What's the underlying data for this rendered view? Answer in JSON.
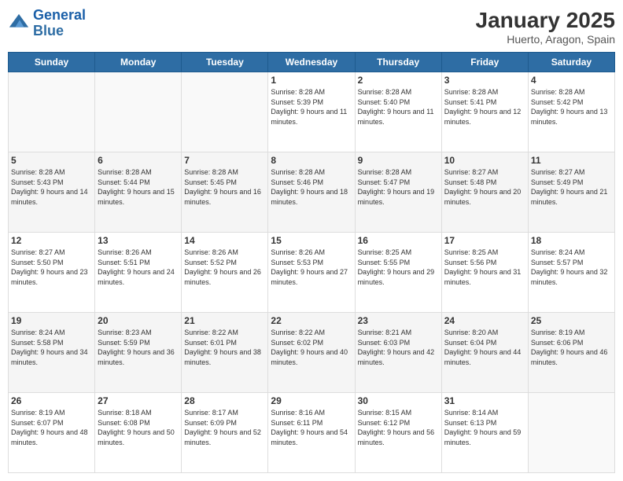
{
  "logo": {
    "line1": "General",
    "line2": "Blue"
  },
  "title": "January 2025",
  "subtitle": "Huerto, Aragon, Spain",
  "days_header": [
    "Sunday",
    "Monday",
    "Tuesday",
    "Wednesday",
    "Thursday",
    "Friday",
    "Saturday"
  ],
  "weeks": [
    [
      {
        "day": "",
        "sunrise": "",
        "sunset": "",
        "daylight": ""
      },
      {
        "day": "",
        "sunrise": "",
        "sunset": "",
        "daylight": ""
      },
      {
        "day": "",
        "sunrise": "",
        "sunset": "",
        "daylight": ""
      },
      {
        "day": "1",
        "sunrise": "Sunrise: 8:28 AM",
        "sunset": "Sunset: 5:39 PM",
        "daylight": "Daylight: 9 hours and 11 minutes."
      },
      {
        "day": "2",
        "sunrise": "Sunrise: 8:28 AM",
        "sunset": "Sunset: 5:40 PM",
        "daylight": "Daylight: 9 hours and 11 minutes."
      },
      {
        "day": "3",
        "sunrise": "Sunrise: 8:28 AM",
        "sunset": "Sunset: 5:41 PM",
        "daylight": "Daylight: 9 hours and 12 minutes."
      },
      {
        "day": "4",
        "sunrise": "Sunrise: 8:28 AM",
        "sunset": "Sunset: 5:42 PM",
        "daylight": "Daylight: 9 hours and 13 minutes."
      }
    ],
    [
      {
        "day": "5",
        "sunrise": "Sunrise: 8:28 AM",
        "sunset": "Sunset: 5:43 PM",
        "daylight": "Daylight: 9 hours and 14 minutes."
      },
      {
        "day": "6",
        "sunrise": "Sunrise: 8:28 AM",
        "sunset": "Sunset: 5:44 PM",
        "daylight": "Daylight: 9 hours and 15 minutes."
      },
      {
        "day": "7",
        "sunrise": "Sunrise: 8:28 AM",
        "sunset": "Sunset: 5:45 PM",
        "daylight": "Daylight: 9 hours and 16 minutes."
      },
      {
        "day": "8",
        "sunrise": "Sunrise: 8:28 AM",
        "sunset": "Sunset: 5:46 PM",
        "daylight": "Daylight: 9 hours and 18 minutes."
      },
      {
        "day": "9",
        "sunrise": "Sunrise: 8:28 AM",
        "sunset": "Sunset: 5:47 PM",
        "daylight": "Daylight: 9 hours and 19 minutes."
      },
      {
        "day": "10",
        "sunrise": "Sunrise: 8:27 AM",
        "sunset": "Sunset: 5:48 PM",
        "daylight": "Daylight: 9 hours and 20 minutes."
      },
      {
        "day": "11",
        "sunrise": "Sunrise: 8:27 AM",
        "sunset": "Sunset: 5:49 PM",
        "daylight": "Daylight: 9 hours and 21 minutes."
      }
    ],
    [
      {
        "day": "12",
        "sunrise": "Sunrise: 8:27 AM",
        "sunset": "Sunset: 5:50 PM",
        "daylight": "Daylight: 9 hours and 23 minutes."
      },
      {
        "day": "13",
        "sunrise": "Sunrise: 8:26 AM",
        "sunset": "Sunset: 5:51 PM",
        "daylight": "Daylight: 9 hours and 24 minutes."
      },
      {
        "day": "14",
        "sunrise": "Sunrise: 8:26 AM",
        "sunset": "Sunset: 5:52 PM",
        "daylight": "Daylight: 9 hours and 26 minutes."
      },
      {
        "day": "15",
        "sunrise": "Sunrise: 8:26 AM",
        "sunset": "Sunset: 5:53 PM",
        "daylight": "Daylight: 9 hours and 27 minutes."
      },
      {
        "day": "16",
        "sunrise": "Sunrise: 8:25 AM",
        "sunset": "Sunset: 5:55 PM",
        "daylight": "Daylight: 9 hours and 29 minutes."
      },
      {
        "day": "17",
        "sunrise": "Sunrise: 8:25 AM",
        "sunset": "Sunset: 5:56 PM",
        "daylight": "Daylight: 9 hours and 31 minutes."
      },
      {
        "day": "18",
        "sunrise": "Sunrise: 8:24 AM",
        "sunset": "Sunset: 5:57 PM",
        "daylight": "Daylight: 9 hours and 32 minutes."
      }
    ],
    [
      {
        "day": "19",
        "sunrise": "Sunrise: 8:24 AM",
        "sunset": "Sunset: 5:58 PM",
        "daylight": "Daylight: 9 hours and 34 minutes."
      },
      {
        "day": "20",
        "sunrise": "Sunrise: 8:23 AM",
        "sunset": "Sunset: 5:59 PM",
        "daylight": "Daylight: 9 hours and 36 minutes."
      },
      {
        "day": "21",
        "sunrise": "Sunrise: 8:22 AM",
        "sunset": "Sunset: 6:01 PM",
        "daylight": "Daylight: 9 hours and 38 minutes."
      },
      {
        "day": "22",
        "sunrise": "Sunrise: 8:22 AM",
        "sunset": "Sunset: 6:02 PM",
        "daylight": "Daylight: 9 hours and 40 minutes."
      },
      {
        "day": "23",
        "sunrise": "Sunrise: 8:21 AM",
        "sunset": "Sunset: 6:03 PM",
        "daylight": "Daylight: 9 hours and 42 minutes."
      },
      {
        "day": "24",
        "sunrise": "Sunrise: 8:20 AM",
        "sunset": "Sunset: 6:04 PM",
        "daylight": "Daylight: 9 hours and 44 minutes."
      },
      {
        "day": "25",
        "sunrise": "Sunrise: 8:19 AM",
        "sunset": "Sunset: 6:06 PM",
        "daylight": "Daylight: 9 hours and 46 minutes."
      }
    ],
    [
      {
        "day": "26",
        "sunrise": "Sunrise: 8:19 AM",
        "sunset": "Sunset: 6:07 PM",
        "daylight": "Daylight: 9 hours and 48 minutes."
      },
      {
        "day": "27",
        "sunrise": "Sunrise: 8:18 AM",
        "sunset": "Sunset: 6:08 PM",
        "daylight": "Daylight: 9 hours and 50 minutes."
      },
      {
        "day": "28",
        "sunrise": "Sunrise: 8:17 AM",
        "sunset": "Sunset: 6:09 PM",
        "daylight": "Daylight: 9 hours and 52 minutes."
      },
      {
        "day": "29",
        "sunrise": "Sunrise: 8:16 AM",
        "sunset": "Sunset: 6:11 PM",
        "daylight": "Daylight: 9 hours and 54 minutes."
      },
      {
        "day": "30",
        "sunrise": "Sunrise: 8:15 AM",
        "sunset": "Sunset: 6:12 PM",
        "daylight": "Daylight: 9 hours and 56 minutes."
      },
      {
        "day": "31",
        "sunrise": "Sunrise: 8:14 AM",
        "sunset": "Sunset: 6:13 PM",
        "daylight": "Daylight: 9 hours and 59 minutes."
      },
      {
        "day": "",
        "sunrise": "",
        "sunset": "",
        "daylight": ""
      }
    ]
  ]
}
